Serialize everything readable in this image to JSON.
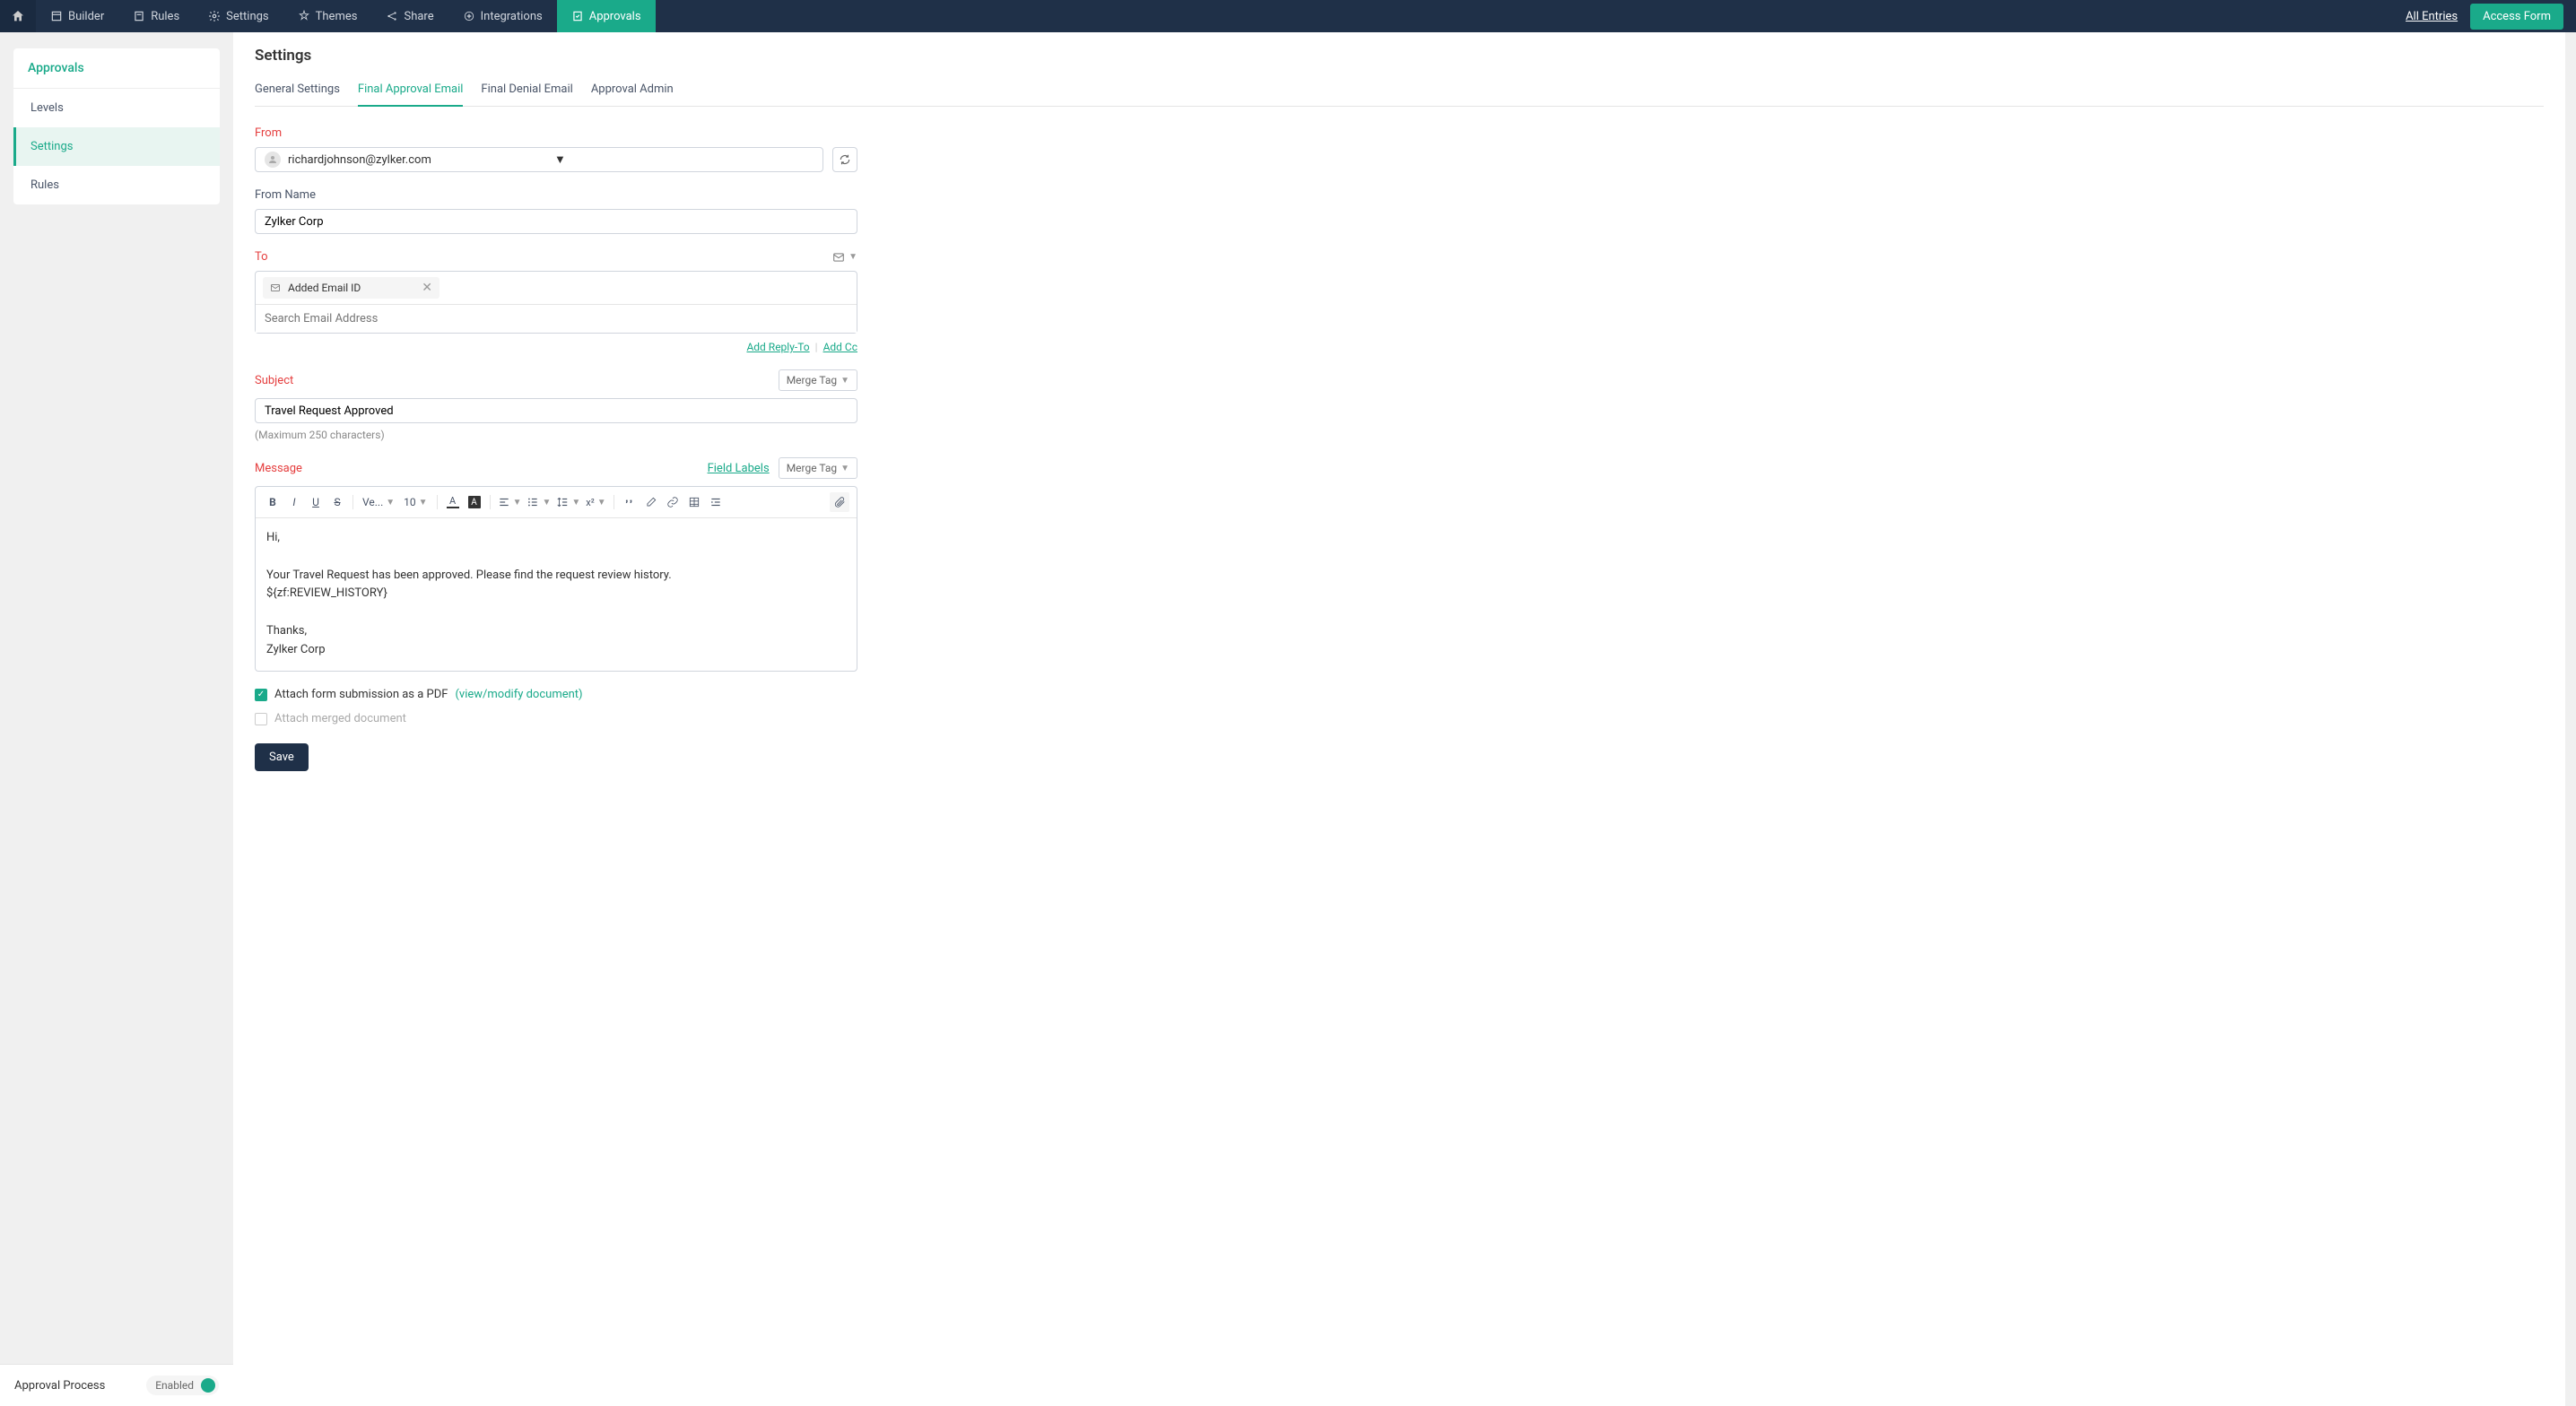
{
  "topNav": {
    "items": [
      {
        "label": "Builder"
      },
      {
        "label": "Rules"
      },
      {
        "label": "Settings"
      },
      {
        "label": "Themes"
      },
      {
        "label": "Share"
      },
      {
        "label": "Integrations"
      },
      {
        "label": "Approvals"
      }
    ],
    "allEntries": "All Entries",
    "accessForm": "Access Form"
  },
  "sidebar": {
    "header": "Approvals",
    "items": [
      {
        "label": "Levels"
      },
      {
        "label": "Settings"
      },
      {
        "label": "Rules"
      }
    ],
    "footer": {
      "label": "Approval Process",
      "status": "Enabled"
    }
  },
  "page": {
    "title": "Settings",
    "tabs": [
      {
        "label": "General Settings"
      },
      {
        "label": "Final Approval Email"
      },
      {
        "label": "Final Denial Email"
      },
      {
        "label": "Approval Admin"
      }
    ]
  },
  "form": {
    "fromLabel": "From",
    "fromValue": "richardjohnson@zylker.com",
    "fromNameLabel": "From Name",
    "fromNameValue": "Zylker Corp",
    "toLabel": "To",
    "toChip": "Added Email ID",
    "toSearchPlaceholder": "Search Email Address",
    "addReplyTo": "Add Reply-To",
    "addCc": "Add Cc",
    "subjectLabel": "Subject",
    "subjectValue": "Travel Request Approved",
    "subjectHelp": "(Maximum 250 characters)",
    "mergeTag": "Merge Tag",
    "messageLabel": "Message",
    "fieldLabels": "Field Labels",
    "messageBody": {
      "line1": "Hi,",
      "line2": "Your Travel Request has been approved. Please find the request review history.",
      "line3": "${zf:REVIEW_HISTORY}",
      "line4": "Thanks,",
      "line5": "Zylker Corp"
    },
    "toolbar": {
      "font": "Ve...",
      "size": "10"
    },
    "attachPdf": "Attach form submission as a PDF",
    "viewModify": "(view/modify document)",
    "attachMerged": "Attach merged document",
    "save": "Save"
  }
}
